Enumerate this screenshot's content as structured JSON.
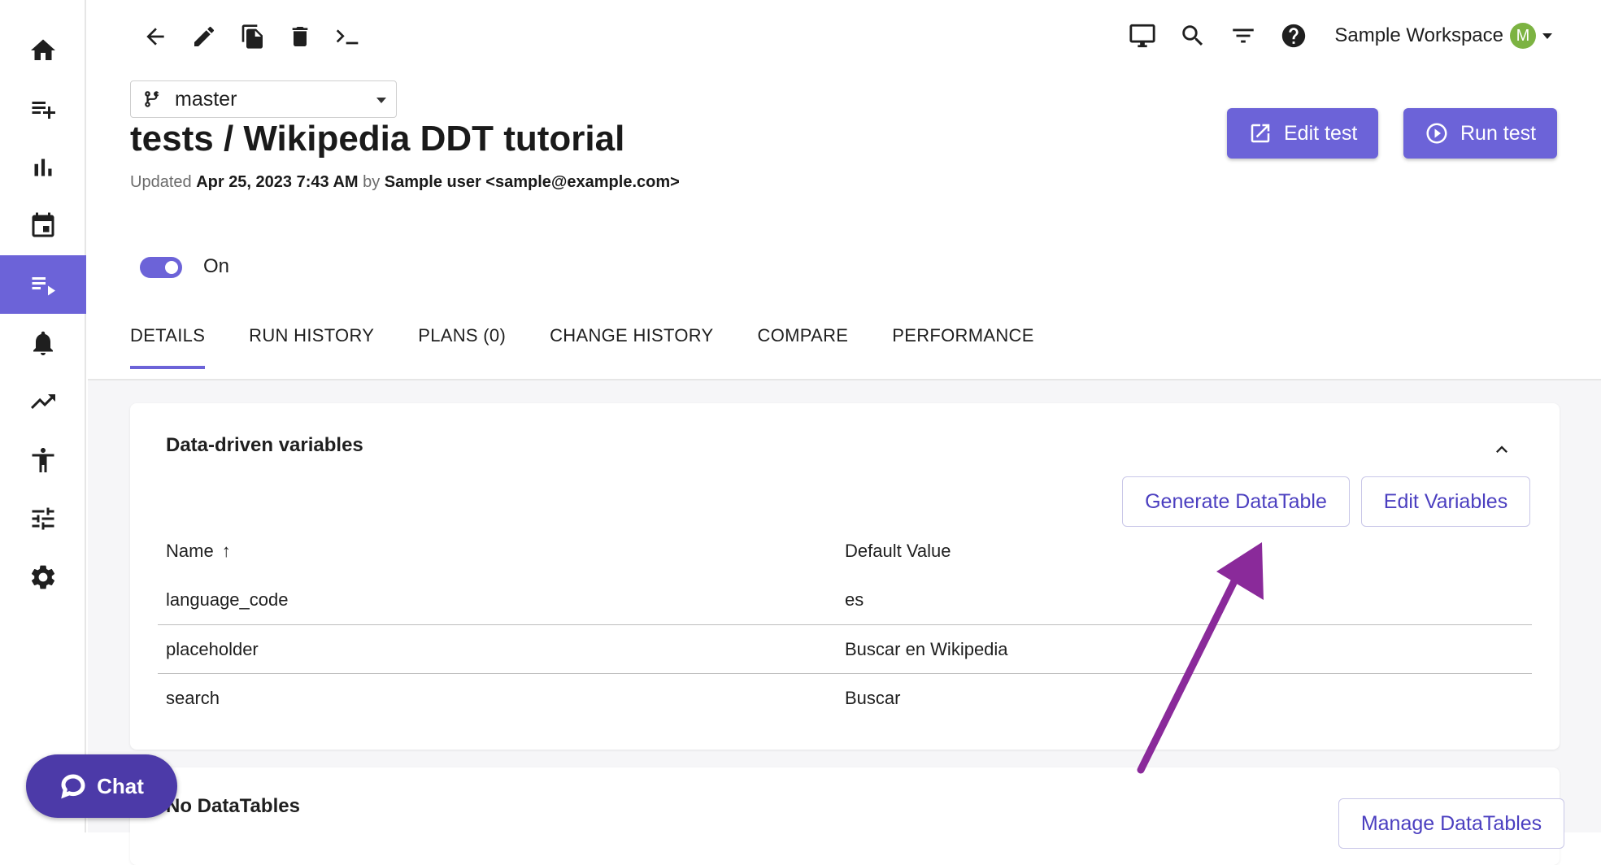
{
  "sidebar": {
    "items": [
      {
        "icon": "home-icon"
      },
      {
        "icon": "playlist-add-icon"
      },
      {
        "icon": "bar-chart-icon"
      },
      {
        "icon": "calendar-icon"
      },
      {
        "icon": "test-list-icon",
        "active": true
      },
      {
        "icon": "bell-icon"
      },
      {
        "icon": "trending-up-icon"
      },
      {
        "icon": "accessibility-icon"
      },
      {
        "icon": "tune-icon"
      },
      {
        "icon": "gear-icon"
      }
    ]
  },
  "toolbar": {
    "icons": [
      "back-arrow-icon",
      "pencil-icon",
      "copy-icon",
      "trash-icon",
      "terminal-icon"
    ]
  },
  "header": {
    "icons": [
      "monitor-icon",
      "search-icon",
      "filter-icon",
      "help-icon"
    ],
    "workspace": "Sample Workspace",
    "avatar_initial": "M"
  },
  "branch": {
    "name": "master"
  },
  "page": {
    "title": "tests / Wikipedia DDT tutorial",
    "updated_prefix": "Updated",
    "updated_date": "Apr 25, 2023 7:43 AM",
    "updated_by": "by",
    "updated_user": "Sample user <sample@example.com>"
  },
  "actions": {
    "edit_label": "Edit test",
    "run_label": "Run test"
  },
  "toggle": {
    "label": "On",
    "on": true
  },
  "tabs": [
    {
      "label": "DETAILS",
      "active": true
    },
    {
      "label": "RUN HISTORY"
    },
    {
      "label": "PLANS (0)"
    },
    {
      "label": "CHANGE HISTORY"
    },
    {
      "label": "COMPARE"
    },
    {
      "label": "PERFORMANCE"
    }
  ],
  "variables_card": {
    "title": "Data-driven variables",
    "generate_label": "Generate DataTable",
    "edit_label": "Edit Variables",
    "columns": {
      "name": "Name",
      "value": "Default Value"
    },
    "rows": [
      {
        "name": "language_code",
        "value": "es"
      },
      {
        "name": "placeholder",
        "value": "Buscar en Wikipedia"
      },
      {
        "name": "search",
        "value": "Buscar"
      }
    ]
  },
  "datatables_card": {
    "title": "No DataTables",
    "manage_label": "Manage DataTables"
  },
  "chat": {
    "label": "Chat"
  },
  "colors": {
    "accent": "#6c63d8",
    "chat": "#4c3aa8",
    "annotation_arrow": "#8a2a9a",
    "avatar": "#7cb342"
  }
}
